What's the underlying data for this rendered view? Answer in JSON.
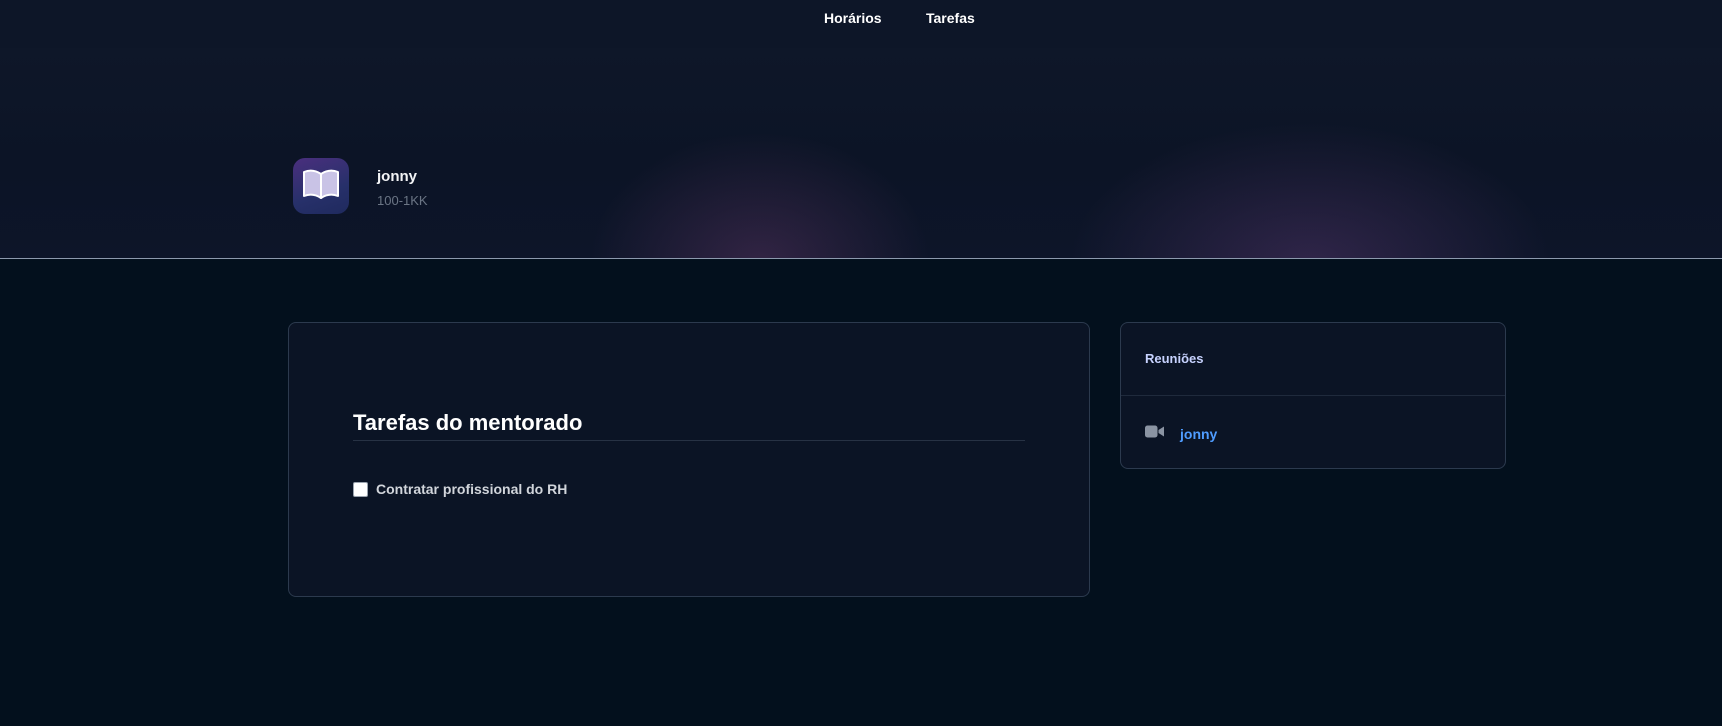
{
  "nav": {
    "items": [
      {
        "label": "Horários"
      },
      {
        "label": "Tarefas"
      }
    ]
  },
  "profile": {
    "icon": "open-book-icon",
    "name": "jonny",
    "subtitle": "100-1KK"
  },
  "tasks": {
    "title": "Tarefas do mentorado",
    "items": [
      {
        "label": "Contratar profissional do RH",
        "checked": false
      }
    ]
  },
  "meetings": {
    "title": "Reuniões",
    "items": [
      {
        "icon": "video-camera-icon",
        "label": "jonny"
      }
    ]
  },
  "colors": {
    "background": "#03101d",
    "nav": "#0d1628",
    "card": "#0b1425",
    "link": "#4f9cff",
    "avatar_gradient_start": "#4a2f7e",
    "avatar_gradient_end": "#1f2a5e"
  }
}
